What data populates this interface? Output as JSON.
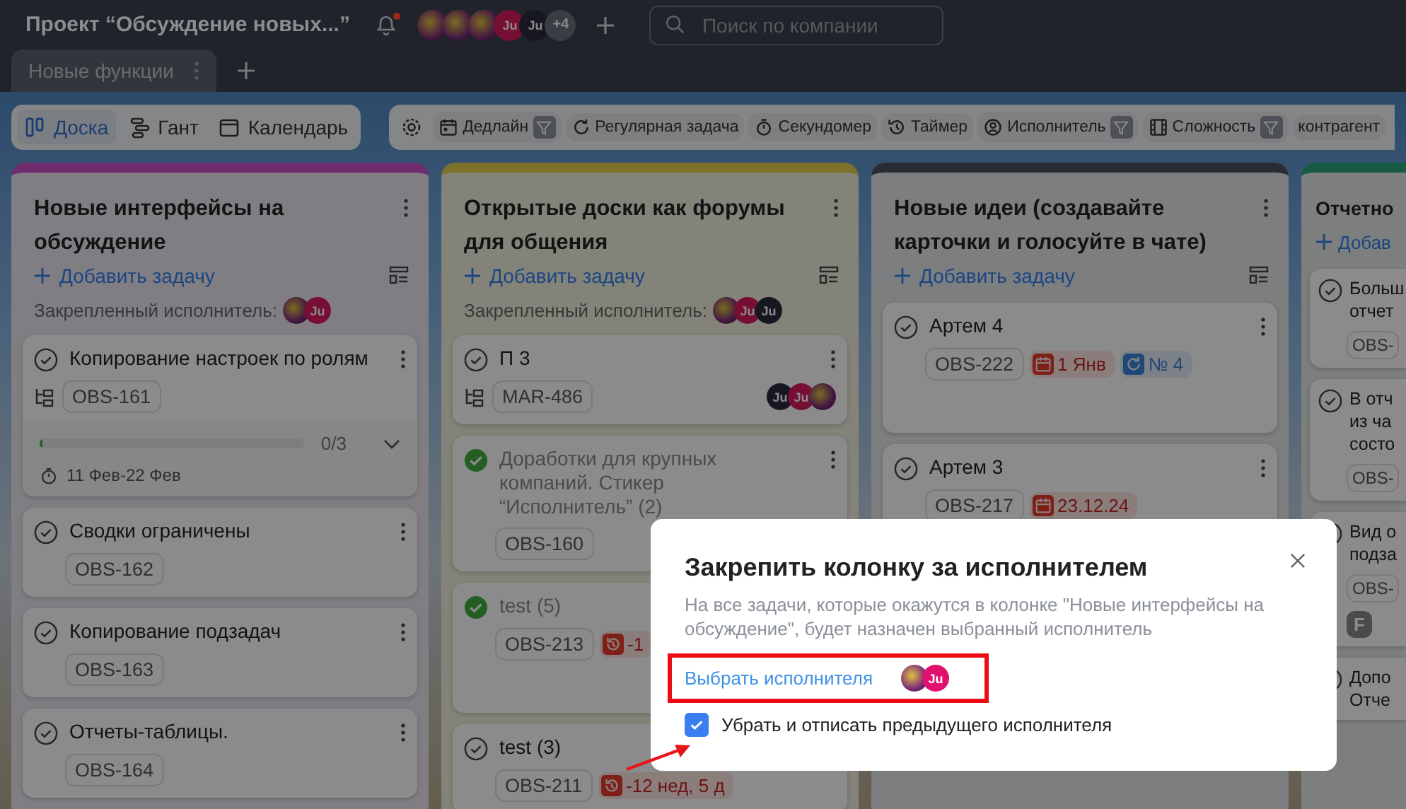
{
  "header": {
    "project_title": "Проект “Обсуждение новых...”",
    "has_notification": true,
    "avatars": [
      {
        "kind": "photo"
      },
      {
        "kind": "photo"
      },
      {
        "kind": "photo"
      },
      {
        "kind": "initials",
        "text": "Ju",
        "color": "#770f35"
      },
      {
        "kind": "initials",
        "text": "Ju",
        "color": "#171721"
      }
    ],
    "more_count": "+4",
    "search": {
      "placeholder": "Поиск по компании"
    }
  },
  "board_tabs": [
    {
      "label": "Новые функции",
      "selected": true
    }
  ],
  "views": [
    {
      "label": "Доска",
      "kind": "board",
      "selected": true
    },
    {
      "label": "Гант",
      "kind": "gantt",
      "selected": false
    },
    {
      "label": "Календарь",
      "kind": "calendar",
      "selected": false
    }
  ],
  "filters": [
    {
      "label": "Дедлайн",
      "kind": "deadline",
      "filter_on": true
    },
    {
      "label": "Регулярная задача",
      "kind": "recurring",
      "filter_on": false
    },
    {
      "label": "Секундомер",
      "kind": "stopwatch",
      "filter_on": false
    },
    {
      "label": "Таймер",
      "kind": "timer",
      "filter_on": false
    },
    {
      "label": "Исполнитель",
      "kind": "assignee",
      "filter_on": true
    },
    {
      "label": "Сложность",
      "kind": "complexity",
      "filter_on": true
    },
    {
      "label": "контрагент",
      "kind": "text",
      "filter_on": false
    }
  ],
  "columns": [
    {
      "kind": "full",
      "title": "Новые интерфейсы на обсуждение",
      "color": "#6e2b6e",
      "add_label": "Добавить задачу",
      "pinned_label": "Закрепленный исполнитель:",
      "pinned_avatars": [
        {
          "kind": "photo"
        },
        {
          "kind": "initials",
          "text": "Ju",
          "color": "#770f35"
        }
      ],
      "cards": [
        {
          "title": "Копирование настроек по ролям",
          "done": false,
          "subtasks": true,
          "code": "OBS-161",
          "progress": {
            "level": 0,
            "reading": "0/3"
          },
          "dates": "11 Фев-22 Фев"
        },
        {
          "title": "Сводки ограничены",
          "done": false,
          "subtasks": false,
          "code": "OBS-162"
        },
        {
          "title": "Копирование подзадач",
          "done": false,
          "subtasks": false,
          "code": "OBS-163"
        },
        {
          "title": "Отчеты-таблицы.",
          "done": false,
          "subtasks": false,
          "code": "OBS-164"
        }
      ]
    },
    {
      "kind": "full",
      "title": "Открытые доски как форумы для общения",
      "color": "#7e722b",
      "add_label": "Добавить задачу",
      "pinned_label": "Закрепленный исполнитель:",
      "pinned_avatars": [
        {
          "kind": "photo"
        },
        {
          "kind": "initials",
          "text": "Ju",
          "color": "#770f35"
        },
        {
          "kind": "initials",
          "text": "Ju",
          "color": "#171721"
        }
      ],
      "cards": [
        {
          "title": "П 3",
          "done": false,
          "subtasks": true,
          "code": "MAR-486",
          "avatars": [
            {
              "kind": "initials",
              "text": "Ju",
              "color": "#171721"
            },
            {
              "kind": "initials",
              "text": "Ju",
              "color": "#770f35"
            },
            {
              "kind": "photo"
            }
          ]
        },
        {
          "title": "Доработки для крупных компаний. Стикер “Исполнитель” (2)",
          "done": true,
          "subtasks": false,
          "code": "OBS-160"
        },
        {
          "title": "test (5)",
          "done": true,
          "subtasks": false,
          "code": "OBS-213",
          "tags": [
            {
              "kind": "overdue",
              "text": "-1"
            }
          ],
          "tall": true
        },
        {
          "title": "test (3)",
          "done": false,
          "subtasks": false,
          "code": "OBS-211",
          "tags": [
            {
              "kind": "overdue",
              "text": "-12 нед, 5 д"
            }
          ]
        }
      ]
    },
    {
      "kind": "full",
      "title": "Новые идеи (создавайте карточки и голосуйте в чате)",
      "color": "#292c32",
      "add_label": "Добавить задачу",
      "cards": [
        {
          "title": "Артем 4",
          "done": false,
          "subtasks": false,
          "code": "OBS-222",
          "tags": [
            {
              "kind": "deadline",
              "text": "1 Янв"
            },
            {
              "kind": "recurring",
              "text": "№ 4"
            }
          ],
          "tall": true
        },
        {
          "title": "Артем 3",
          "done": false,
          "subtasks": false,
          "code": "OBS-217",
          "tags": [
            {
              "kind": "deadline",
              "text": "23.12.24"
            }
          ]
        }
      ]
    },
    {
      "kind": "cut",
      "title": "Отчетно",
      "color": "#175a43",
      "add_label": "Добав",
      "cards": [
        {
          "title": "Больш\nотчет",
          "done": false,
          "subtasks": false,
          "code": "OBS-"
        },
        {
          "title": "В отч\nиз ча\nсосто",
          "done": false,
          "subtasks": false,
          "code": "OBS-"
        },
        {
          "title": "Вид о\nподза",
          "done": false,
          "subtasks": false,
          "code": "OBS-",
          "tags": [
            {
              "kind": "letter",
              "text": "F"
            }
          ]
        },
        {
          "title": "Допо\nОтче",
          "done": false,
          "subtasks": false
        }
      ]
    }
  ],
  "dialog": {
    "title": "Закрепить колонку за исполнителем",
    "description": "На все задачи, которые окажутся в колонке \"Новые интерфейсы на обсуждение\", будет назначен выбранный исполнитель",
    "choose_link": "Выбрать исполнителя",
    "avatars": [
      {
        "kind": "photo"
      },
      {
        "kind": "initials",
        "text": "Ju",
        "color": "#e0126e"
      }
    ],
    "checkbox": {
      "label": "Убрать и отписать предыдущего исполнителя",
      "checked": true
    }
  }
}
